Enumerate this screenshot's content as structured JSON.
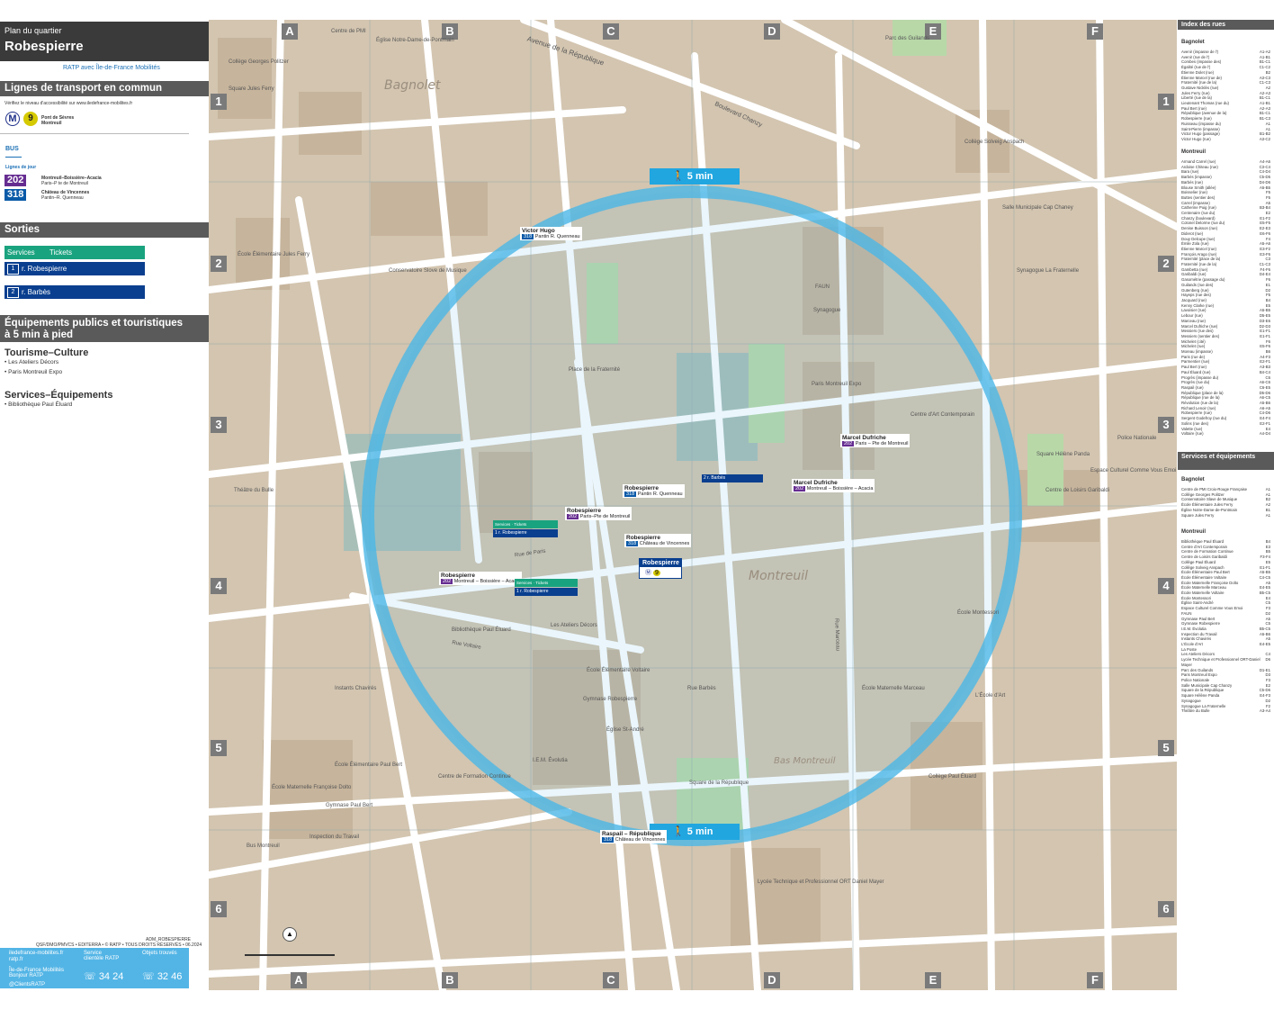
{
  "header": {
    "small": "Plan du quartier",
    "station": "Robespierre",
    "operator": "RATP avec Île-de-France Mobilités"
  },
  "transport": {
    "title": "Lignes de transport en commun",
    "note": "Vérifiez le niveau d'accessibilité sur www.iledefrance-mobilites.fr",
    "metro": {
      "letter": "M",
      "line": "9",
      "dest1": "Pont de Sèvres",
      "dest2": "Montreuil"
    },
    "bus_label": "BUS",
    "day_label": "Lignes de jour",
    "buses": [
      {
        "num": "202",
        "color": "#662d91",
        "dest1": "Montreuil–Boissière–Acacia",
        "dest2": "Paris–P te de Montreuil"
      },
      {
        "num": "318",
        "color": "#0a5aa8",
        "dest1": "Château de Vincennes",
        "dest2": "Pantin–R. Quenneau"
      }
    ]
  },
  "exits": {
    "title": "Sorties",
    "services": "Services",
    "tickets": "Tickets",
    "items": [
      {
        "num": "1",
        "label": "r. Robespierre"
      },
      {
        "num": "2",
        "label": "r. Barbès"
      }
    ]
  },
  "equipment": {
    "title_line1": "Équipements publics et touristiques",
    "title_line2": "à 5 min à pied",
    "cat1": "Tourisme–Culture",
    "cat1_items": [
      "Les Ateliers Décors",
      "Paris Montreuil Expo"
    ],
    "cat2": "Services–Équipements",
    "cat2_items": [
      "Bibliothèque Paul Éluard"
    ]
  },
  "footer": {
    "code": "ADM_ROBESPIERRE",
    "credits": "QSF/DMO/PMVCS • EDITERRA • © RATP • TOUS DROITS RÉSERVÉS • 06.2024",
    "web1": "iledefrance-mobilites.fr",
    "web2": "ratp.fr",
    "app1": "Île-de-France Mobilités",
    "app2": "Bonjour RATP",
    "twitter": "@ClientsRATP",
    "svc_client": "Service clientèle RATP",
    "phone1": "34 24",
    "lost": "Objets trouvés",
    "phone2": "32 46"
  },
  "map": {
    "grid_cols": [
      "A",
      "B",
      "C",
      "D",
      "E",
      "F"
    ],
    "grid_rows": [
      "1",
      "2",
      "3",
      "4",
      "5",
      "6"
    ],
    "areas": [
      "Bagnolet",
      "Montreuil",
      "Bas Montreuil"
    ],
    "walk_label": "5 min",
    "station_box": "Robespierre",
    "stops": [
      {
        "name": "Victor Hugo",
        "line": "318",
        "dest": "Pantin R. Quenneau"
      },
      {
        "name": "Robespierre",
        "line": "318",
        "dest": "Pantin R. Quenneau"
      },
      {
        "name": "Robespierre",
        "line": "202",
        "dest": "Paris–Pte de Montreuil"
      },
      {
        "name": "Robespierre",
        "line": "318",
        "dest": "Château de Vincennes"
      },
      {
        "name": "Robespierre",
        "line": "202",
        "dest": "Montreuil – Boissière – Acacia"
      },
      {
        "name": "Marcel Dufriche",
        "line": "202",
        "dest": "Paris – Pte de Montreuil"
      },
      {
        "name": "Marcel Dufriche",
        "line": "202",
        "dest": "Montreuil – Boissière – Acacia"
      },
      {
        "name": "Raspail – République",
        "line": "318",
        "dest": "Château de Vincennes"
      }
    ],
    "labels": [
      "Place de la Fraternité",
      "Conservatoire Slove de Musique",
      "Paris Montreuil Expo",
      "Centre d'Art Contemporain",
      "Bibliothèque Paul Éluard",
      "Les Ateliers Décors",
      "École Élémentaire Voltaire",
      "Gymnase Robespierre",
      "Église St-André",
      "Square de la République",
      "Collège Paul Éluard",
      "Lycée Technique et Professionnel ORT Daniel Mayer",
      "Collège Solveig Anspach",
      "Synagogue La Fraternelle",
      "Police Nationale",
      "Square Hélène Panda",
      "Avenue de la République",
      "Boulevard Chanzy",
      "Rue de Paris",
      "Rue Marceau",
      "Rue Voltaire",
      "Rue Barbès",
      "Collège Georges Politzer",
      "Centre de PMI",
      "Église Notre-Dame-de-Pontmain",
      "Square Jules Ferry",
      "École Élémentaire Jules Ferry",
      "Théâtre du Bulle",
      "Instants Chavirés",
      "École Élémentaire Paul Bert",
      "Gymnase Paul Bert",
      "Centre de Formation Continue",
      "I.E.M. Évolutia",
      "Inspection du Travail",
      "Bus Montreuil",
      "École Maternelle Françoise Dolto",
      "FAUN",
      "Synagogue",
      "Parc des Guilands",
      "Salle Municipale Cap Chaney",
      "Espace Culturel Comme Vous Emoi",
      "Centre de Loisirs Garibaldi",
      "École Maternelle Marceau",
      "L'École d'Art",
      "École Montessori"
    ]
  },
  "index": {
    "title": "Index des rues",
    "bagnolet": "Bagnolet",
    "bagnolet_streets": [
      [
        "Avenir (impasse de l')",
        "A1-A2"
      ],
      [
        "Avenir (rue de l')",
        "A1-B1"
      ],
      [
        "Combes (impasse des)",
        "B1-C1"
      ],
      [
        "Égalité (rue de l')",
        "C1-C2"
      ],
      [
        "Étienne Dolet (rue)",
        "B2"
      ],
      [
        "Étienne Marcel (rue de)",
        "A3-C3"
      ],
      [
        "Fraternité (rue de la)",
        "C1-C3"
      ],
      [
        "Gustave Nicklès (rue)",
        "A2"
      ],
      [
        "Jules Ferry (rue)",
        "A2-A3"
      ],
      [
        "Liberté (rue de la)",
        "B1-C1"
      ],
      [
        "Lieutenant Thomas (rue du)",
        "A1-B1"
      ],
      [
        "Paul Bert (rue)",
        "A2-A3"
      ],
      [
        "République (avenue de la)",
        "B1-C1"
      ],
      [
        "Robespierre (rue)",
        "B1-C3"
      ],
      [
        "Ruisseau (impasse du)",
        "A1"
      ],
      [
        "Saint-Pierre (impasse)",
        "A1"
      ],
      [
        "Victor Hugo (passage)",
        "B1-B2"
      ],
      [
        "Victor Hugo (rue)",
        "A3-C2"
      ]
    ],
    "montreuil": "Montreuil",
    "montreuil_streets": [
      [
        "Armand Carrel (rue)",
        "A4-A6"
      ],
      [
        "Ardoise Chiteau (rue)",
        "C3-C4"
      ],
      [
        "Bara (rue)",
        "C4-D4"
      ],
      [
        "Barbès (impasse)",
        "C5-D5"
      ],
      [
        "Barbès (rue)",
        "D4-D6"
      ],
      [
        "Blouse Smith (allée)",
        "A5-B5"
      ],
      [
        "Boisselier (rue)",
        "F5"
      ],
      [
        "Buttes (sentier des)",
        "F5"
      ],
      [
        "Carrel (impasse)",
        "A5"
      ],
      [
        "Catherine Puig (rue)",
        "B3-B4"
      ],
      [
        "Centenaire (rue du)",
        "E2"
      ],
      [
        "Chanzy (boulevard)",
        "E1-F2"
      ],
      [
        "Colonel Delorme (rue du)",
        "E5-F5"
      ],
      [
        "Denise Buisson (rue)",
        "E2-E3"
      ],
      [
        "Diderot (rue)",
        "E6-F6"
      ],
      [
        "Douy Delcupe (rue)",
        "F4"
      ],
      [
        "Émile Zola (rue)",
        "A5-A6"
      ],
      [
        "Étienne Marcel (rue)",
        "E3-F2"
      ],
      [
        "François Arago (rue)",
        "E3-F6"
      ],
      [
        "Fraternité (place de la)",
        "C3"
      ],
      [
        "Fraternité (rue de la)",
        "C1-C3"
      ],
      [
        "Gambetta (rue)",
        "F4-F6"
      ],
      [
        "Garibaldi (rue)",
        "D4-E4"
      ],
      [
        "Gasométrie (passage du)",
        "F6"
      ],
      [
        "Guilands (rue des)",
        "E1"
      ],
      [
        "Gutenberg (rue)",
        "D2"
      ],
      [
        "Hayeps (rue des)",
        "F5"
      ],
      [
        "Jacquard (rue)",
        "B4"
      ],
      [
        "Kenny Clarke (rue)",
        "E5"
      ],
      [
        "Lavoisier (rue)",
        "A5-B5"
      ],
      [
        "Lebour (rue)",
        "D5-E5"
      ],
      [
        "Marceau (rue)",
        "D3-E6"
      ],
      [
        "Marcel Dufriche (rue)",
        "D2-D3"
      ],
      [
        "Messiers (rue des)",
        "E1-F1"
      ],
      [
        "Messiers (sentier des)",
        "E1-F1"
      ],
      [
        "Michelet (cité)",
        "F6"
      ],
      [
        "Michelet (rue)",
        "E5-F6"
      ],
      [
        "Moreau (impasse)",
        "B6"
      ],
      [
        "Paris (rue de)",
        "A4-F3"
      ],
      [
        "Parmentier (rue)",
        "E2-F1"
      ],
      [
        "Paul Bert (rue)",
        "A3-B3"
      ],
      [
        "Paul Éluard (rue)",
        "B4-C4"
      ],
      [
        "Progrès (impasse du)",
        "C6"
      ],
      [
        "Progrès (rue du)",
        "A6-C6"
      ],
      [
        "Raspail (rue)",
        "C6-E5"
      ],
      [
        "République (place de la)",
        "D5-D6"
      ],
      [
        "République (rue de la)",
        "A6-C5"
      ],
      [
        "Révolution (rue de la)",
        "A5-B6"
      ],
      [
        "Richard Lenoir (rue)",
        "A6-A5"
      ],
      [
        "Robespierre (rue)",
        "C4-D6"
      ],
      [
        "Sergent Godefroy (rue du)",
        "E4-F4"
      ],
      [
        "Solins (rue des)",
        "E2-F1"
      ],
      [
        "Valette (rue)",
        "E4"
      ],
      [
        "Voltaire (rue)",
        "A4-D4"
      ]
    ],
    "svc_title": "Services et équipements",
    "svc_bagnolet": [
      [
        "Centre de PMI Croix-Rouge Française",
        "A1"
      ],
      [
        "Collège Georges Politzer",
        "A1"
      ],
      [
        "Conservatoire Slave de Musique",
        "B2"
      ],
      [
        "École Élémentaire Jules Ferry",
        "A2"
      ],
      [
        "Église Notre-Dame-de-Pontmain",
        "B1"
      ],
      [
        "Square Jules Ferry",
        "A1"
      ]
    ],
    "svc_montreuil": [
      [
        "Bibliothèque Paul Éluard",
        "B4"
      ],
      [
        "Centre d'Art Contemporain",
        "E3"
      ],
      [
        "Centre de Formation Continue",
        "B5"
      ],
      [
        "Centre de Loisirs Garibaldi",
        "F3-F4"
      ],
      [
        "Collège Paul Éluard",
        "E5"
      ],
      [
        "Collège Solveig Anspach",
        "E1-F1"
      ],
      [
        "École Élémentaire Paul Bert",
        "A5-B5"
      ],
      [
        "École Élémentaire Voltaire",
        "C4-C5"
      ],
      [
        "École Maternelle Françoise Dolto",
        "A5"
      ],
      [
        "École Maternelle Marceau",
        "E4-E5"
      ],
      [
        "École Maternelle Voltaire",
        "B5-C5"
      ],
      [
        "École Montessori",
        "E4"
      ],
      [
        "Église Saint-André",
        "C5"
      ],
      [
        "Espace Culturel Comme Vous Emoi",
        "F3"
      ],
      [
        "FAUN",
        "D2"
      ],
      [
        "Gymnase Paul Bert",
        "A5"
      ],
      [
        "Gymnase Robespierre",
        "C5"
      ],
      [
        "I.E.M. Évolutia",
        "B5-C5"
      ],
      [
        "Inspection du Travail",
        "A5-B6"
      ],
      [
        "Instants Chavirés",
        "A5"
      ],
      [
        "L'École d'Art",
        "E4-E5"
      ],
      [
        "La Poste",
        ""
      ],
      [
        "Les Ateliers Décors",
        "C4"
      ],
      [
        "Lycée Technique et Professionnel ORT-Daniel Mayer",
        "D6"
      ],
      [
        "Parc des Guilands",
        "D1-E1"
      ],
      [
        "Paris Montreuil Expo",
        "D3"
      ],
      [
        "Police Nationale",
        "F3"
      ],
      [
        "Salle Municipale Cap Chanzy",
        "E2"
      ],
      [
        "Square de la République",
        "C5-D6"
      ],
      [
        "Square Hélène Panda",
        "E4-F3"
      ],
      [
        "Synagogue",
        "D2"
      ],
      [
        "Synagogue La Fraternelle",
        "F2"
      ],
      [
        "Théâtre du Bulle",
        "A3-A4"
      ]
    ]
  }
}
